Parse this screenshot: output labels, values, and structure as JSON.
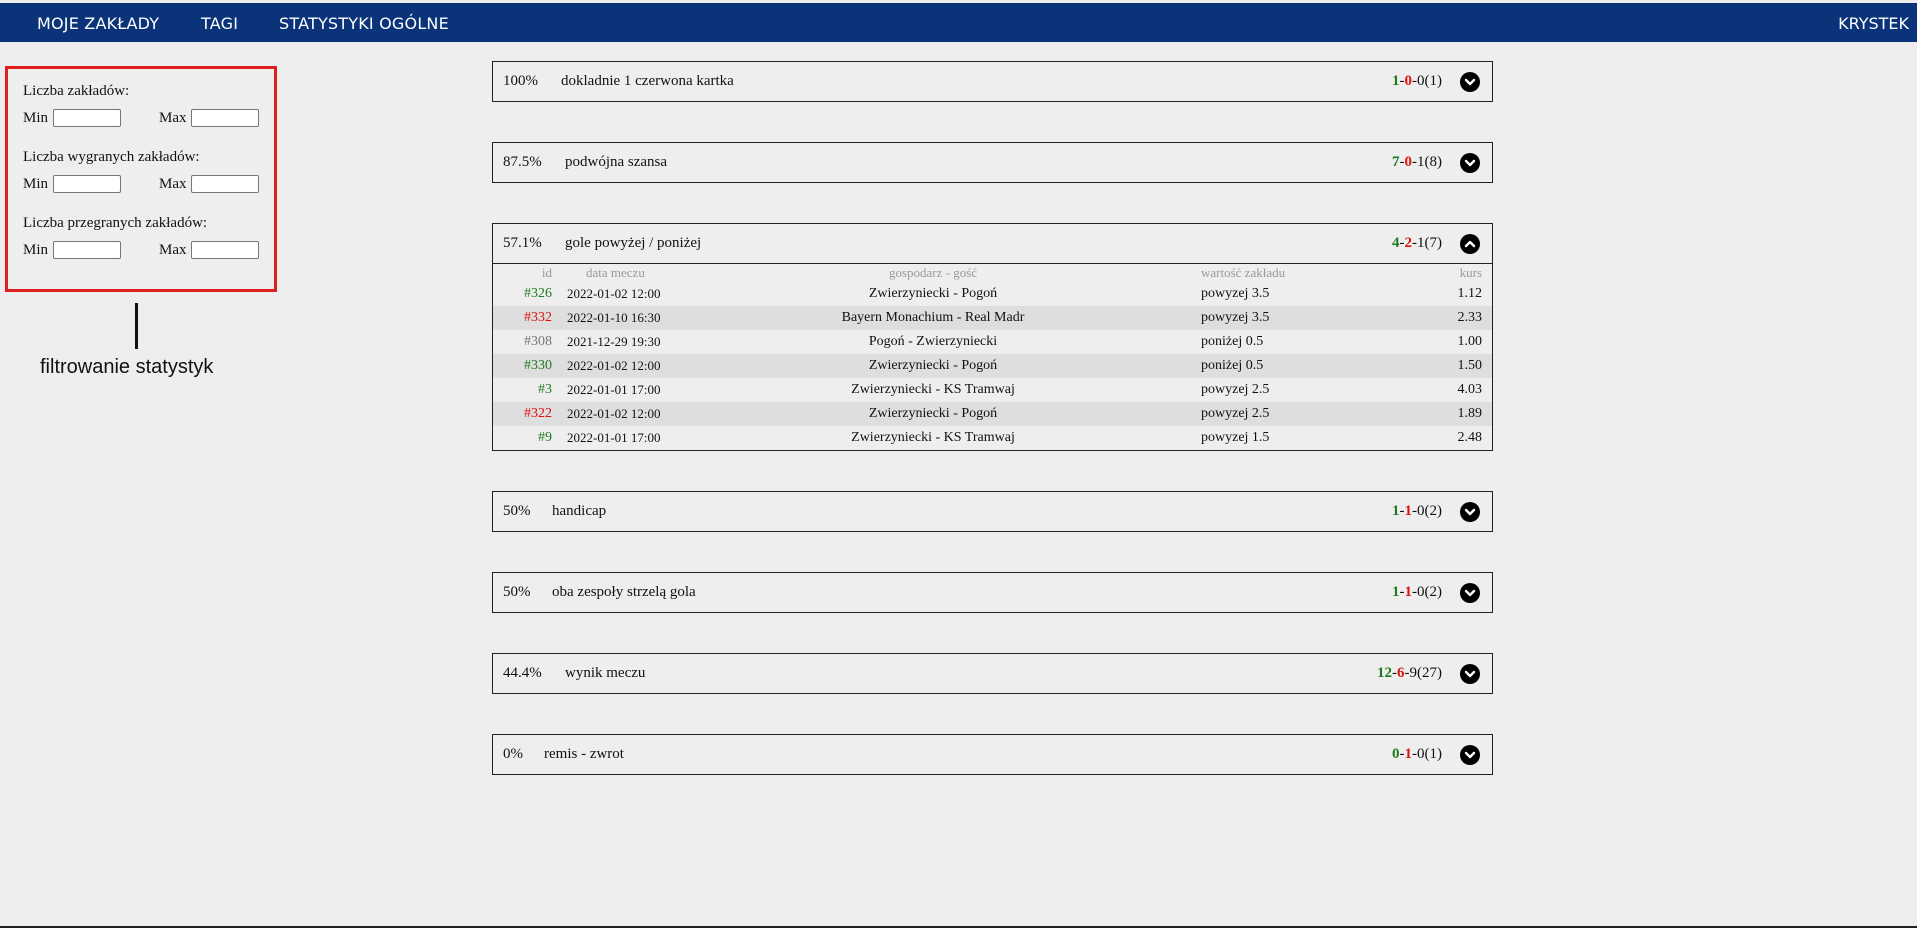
{
  "nav": {
    "items": [
      "MOJE ZAKŁADY",
      "TAGI",
      "STATYSTYKI OGÓLNE"
    ],
    "user": "KRYSTEK"
  },
  "filters": {
    "groups": [
      {
        "label": "Liczba zakładów:",
        "min_label": "Min",
        "max_label": "Max",
        "min_value": "",
        "max_value": ""
      },
      {
        "label": "Liczba wygranych zakładów:",
        "min_label": "Min",
        "max_label": "Max",
        "min_value": "",
        "max_value": ""
      },
      {
        "label": "Liczba przegranych zakładów:",
        "min_label": "Min",
        "max_label": "Max",
        "min_value": "",
        "max_value": ""
      }
    ],
    "annotation": "filtrowanie statystyk"
  },
  "colors": {
    "nav_bg": "#0a337a",
    "win": "#1e7a1e",
    "loss": "#e01010",
    "highlight_border": "#e02020"
  },
  "bets_table_headers": {
    "id": "id",
    "date": "data meczu",
    "match": "gospodarz - gość",
    "value": "wartość zakładu",
    "odds": "kurs"
  },
  "tags": [
    {
      "pct": "100%",
      "name": "dokladnie 1 czerwona kartka",
      "won": "1",
      "lost": "0",
      "returned": "0",
      "total": "(1)",
      "expanded": false,
      "chevron_icon": "chevron-down-icon"
    },
    {
      "pct": "87.5%",
      "name": "podwójna szansa",
      "won": "7",
      "lost": "0",
      "returned": "1",
      "total": "(8)",
      "expanded": false,
      "chevron_icon": "chevron-down-icon"
    },
    {
      "pct": "57.1%",
      "name": "gole powyżej / poniżej",
      "won": "4",
      "lost": "2",
      "returned": "1",
      "total": "(7)",
      "expanded": true,
      "chevron_icon": "chevron-up-icon",
      "bets": [
        {
          "id": "#326",
          "status": "won",
          "date": "2022-01-02 12:00",
          "match": "Zwierzyniecki - Pogoń",
          "value": "powyzej 3.5",
          "odds": "1.12"
        },
        {
          "id": "#332",
          "status": "lost",
          "date": "2022-01-10 16:30",
          "match": "Bayern Monachium - Real Madr",
          "value": "powyzej 3.5",
          "odds": "2.33"
        },
        {
          "id": "#308",
          "status": "returned",
          "date": "2021-12-29 19:30",
          "match": "Pogoń - Zwierzyniecki",
          "value": "poniżej 0.5",
          "odds": "1.00"
        },
        {
          "id": "#330",
          "status": "won",
          "date": "2022-01-02 12:00",
          "match": "Zwierzyniecki - Pogoń",
          "value": "poniżej 0.5",
          "odds": "1.50"
        },
        {
          "id": "#3",
          "status": "won",
          "date": "2022-01-01 17:00",
          "match": "Zwierzyniecki - KS Tramwaj",
          "value": "powyzej 2.5",
          "odds": "4.03"
        },
        {
          "id": "#322",
          "status": "lost",
          "date": "2022-01-02 12:00",
          "match": "Zwierzyniecki - Pogoń",
          "value": "powyzej 2.5",
          "odds": "1.89"
        },
        {
          "id": "#9",
          "status": "won",
          "date": "2022-01-01 17:00",
          "match": "Zwierzyniecki - KS Tramwaj",
          "value": "powyzej 1.5",
          "odds": "2.48"
        }
      ]
    },
    {
      "pct": "50%",
      "name": "handicap",
      "won": "1",
      "lost": "1",
      "returned": "0",
      "total": "(2)",
      "expanded": false,
      "chevron_icon": "chevron-down-icon"
    },
    {
      "pct": "50%",
      "name": "oba zespoły strzelą gola",
      "won": "1",
      "lost": "1",
      "returned": "0",
      "total": "(2)",
      "expanded": false,
      "chevron_icon": "chevron-down-icon"
    },
    {
      "pct": "44.4%",
      "name": "wynik meczu",
      "won": "12",
      "lost": "6",
      "returned": "9",
      "total": "(27)",
      "expanded": false,
      "chevron_icon": "chevron-down-icon"
    },
    {
      "pct": "0%",
      "name": "remis - zwrot",
      "won": "0",
      "lost": "1",
      "returned": "0",
      "total": "(1)",
      "expanded": false,
      "chevron_icon": "chevron-down-icon"
    }
  ]
}
